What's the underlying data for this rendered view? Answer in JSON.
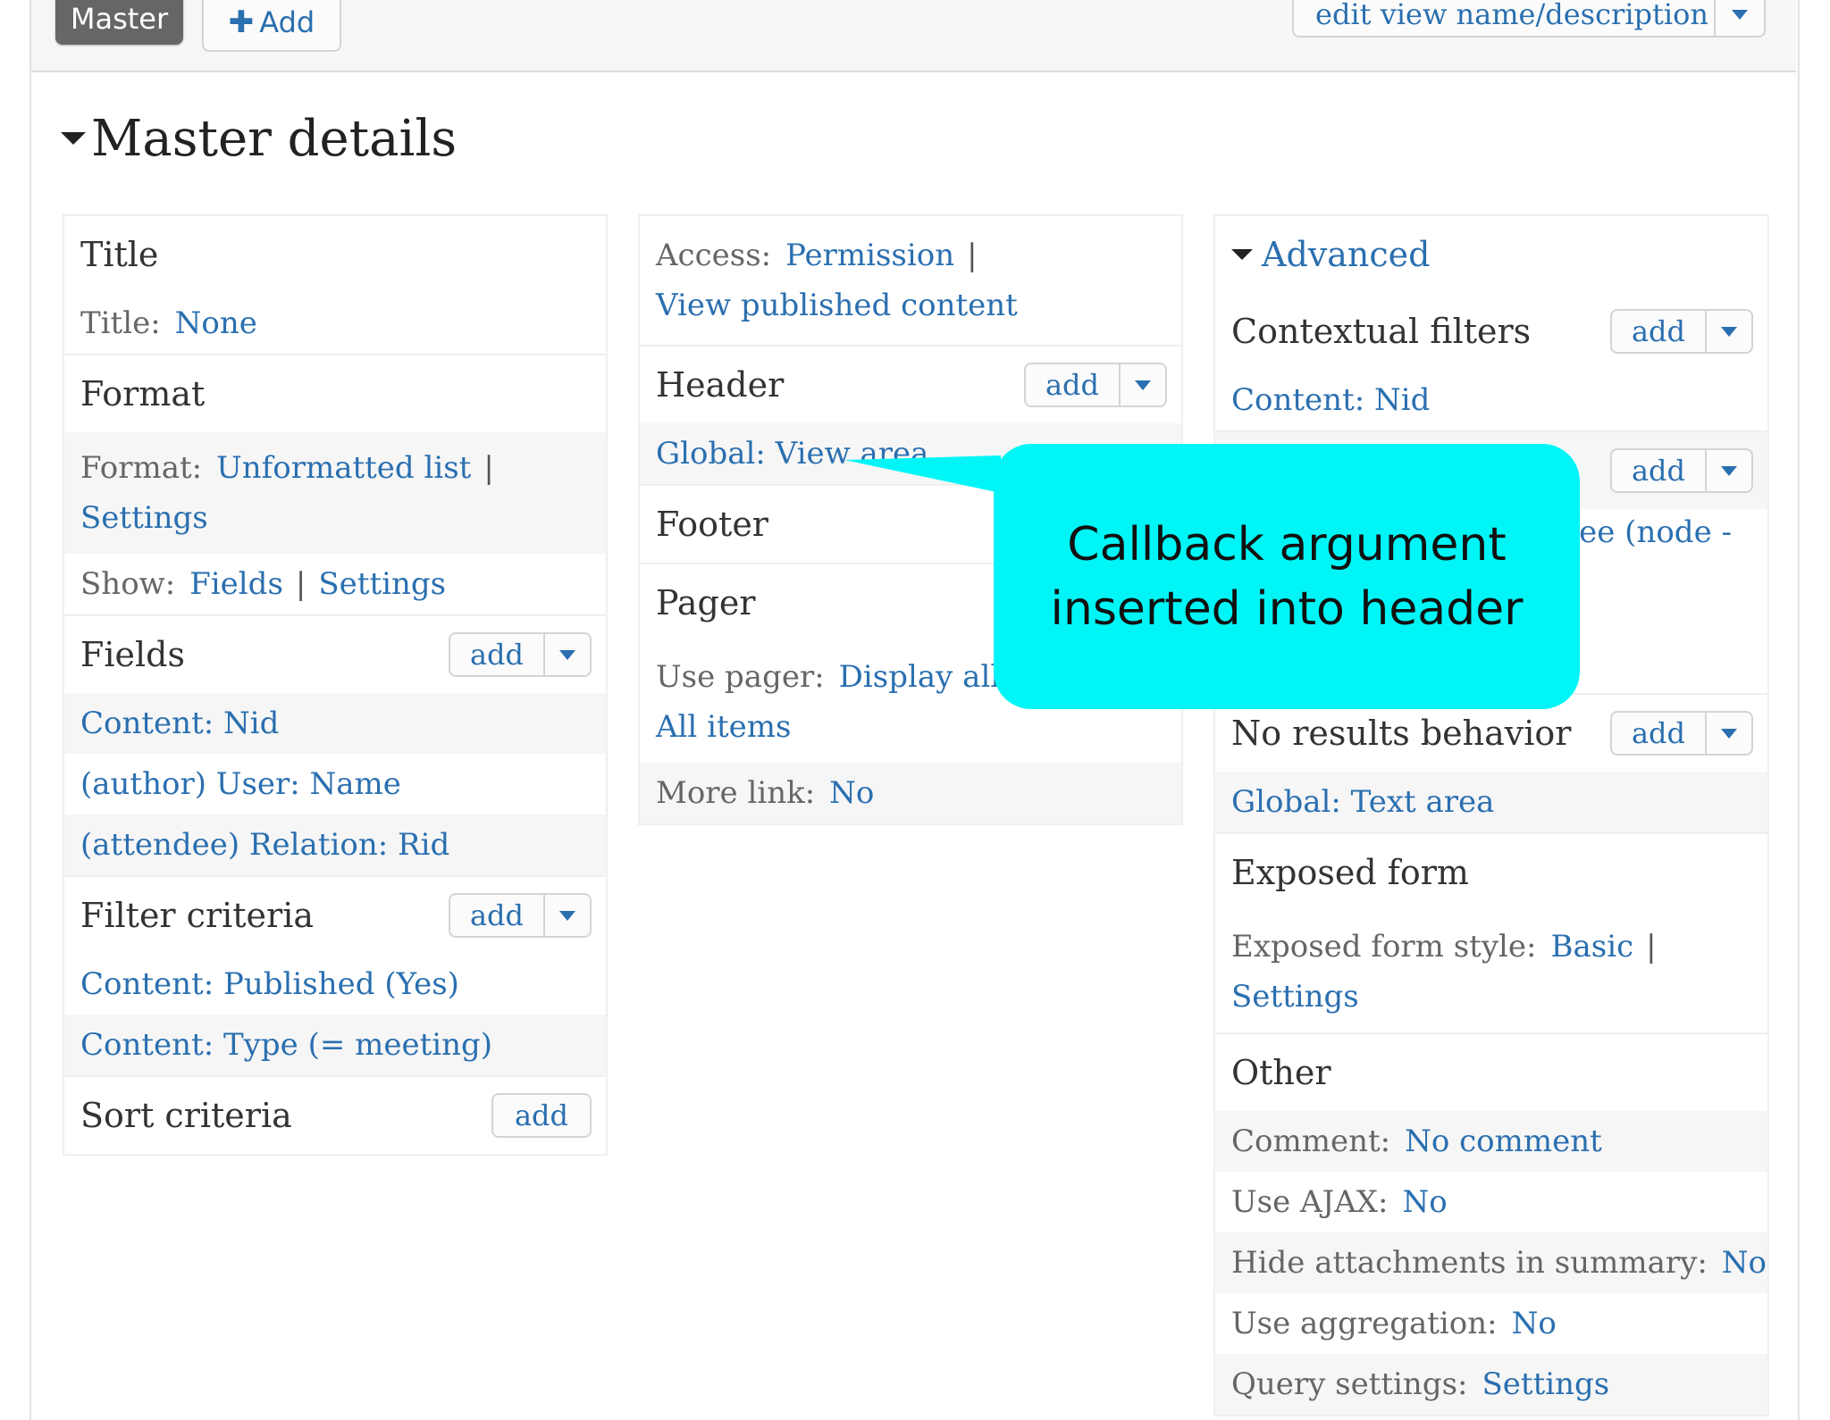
{
  "topbar": {
    "tab_master": "Master",
    "tab_add": "Add",
    "edit_view": "edit view name/description"
  },
  "section_title": "Master details",
  "col1": {
    "title": {
      "heading": "Title",
      "label": "Title:",
      "value": "None"
    },
    "format": {
      "heading": "Format",
      "format_label": "Format:",
      "format_value": "Unformatted list",
      "sep": "|",
      "settings": "Settings",
      "show_label": "Show:",
      "show_value": "Fields",
      "show_settings": "Settings"
    },
    "fields": {
      "heading": "Fields",
      "add": "add",
      "items": [
        "Content: Nid",
        "(author) User: Name",
        "(attendee) Relation: Rid"
      ]
    },
    "filter": {
      "heading": "Filter criteria",
      "add": "add",
      "items": [
        "Content: Published (Yes)",
        "Content: Type (= meeting)"
      ]
    },
    "sort": {
      "heading": "Sort criteria",
      "add": "add"
    }
  },
  "col2": {
    "access": {
      "label": "Access:",
      "value": "Permission",
      "sep": "|",
      "detail": "View published content"
    },
    "header": {
      "heading": "Header",
      "add": "add",
      "item": "Global: View area"
    },
    "footer": {
      "heading": "Footer"
    },
    "pager": {
      "heading": "Pager",
      "use_label": "Use pager:",
      "use_value": "Display all it",
      "items": "All items"
    },
    "more_link": {
      "label": "More link:",
      "value": "No"
    }
  },
  "col3": {
    "advanced": "Advanced",
    "contextual": {
      "heading": "Contextual filters",
      "add": "add",
      "item": "Content: Nid"
    },
    "relationships": {
      "add": "add",
      "partial": "dee (node -"
    },
    "no_results": {
      "heading": "No results behavior",
      "add": "add",
      "item": "Global: Text area"
    },
    "exposed": {
      "heading": "Exposed form",
      "label": "Exposed form style:",
      "value": "Basic",
      "sep": "|",
      "settings": "Settings"
    },
    "other": {
      "heading": "Other",
      "rows": [
        {
          "label": "Comment:",
          "value": "No comment"
        },
        {
          "label": "Use AJAX:",
          "value": "No"
        },
        {
          "label": "Hide attachments in summary:",
          "value": "No"
        },
        {
          "label": "Use aggregation:",
          "value": "No"
        },
        {
          "label": "Query settings:",
          "value": "Settings"
        }
      ]
    }
  },
  "callout": {
    "line1": "Callback argument",
    "line2": "inserted into header",
    "color": "#00f6f6"
  },
  "colors": {
    "link": "#2a6fb0",
    "row_bg": "#f6f6f6",
    "tab_active": "#666666"
  }
}
